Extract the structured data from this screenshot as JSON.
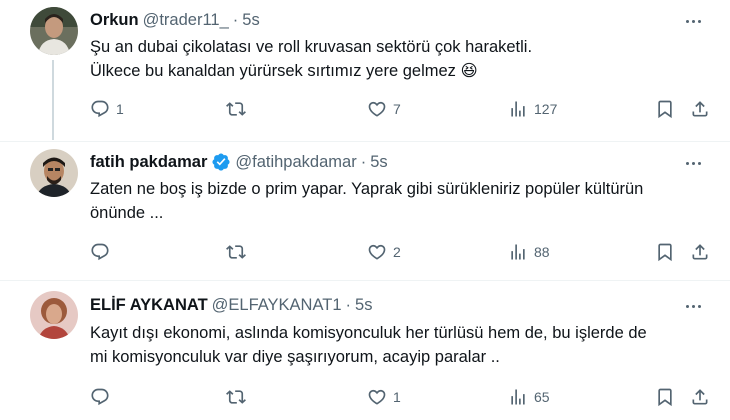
{
  "tweets": [
    {
      "name": "Orkun",
      "handle": "@trader11_",
      "dot": "·",
      "time": "5s",
      "lines": [
        "Şu an dubai çikolatası ve roll kruvasan sektörü çok haraketli.",
        "Ülkece bu kanaldan yürürsek sırtımız yere gelmez 😆"
      ],
      "stats": {
        "replies": "1",
        "retweets": "",
        "likes": "7",
        "views": "127"
      }
    },
    {
      "name": "fatih pakdamar",
      "handle": "@fatihpakdamar",
      "dot": "·",
      "time": "5s",
      "verified": true,
      "lines": [
        "Zaten ne boş iş bizde o prim yapar. Yaprak gibi sürükleniriz popüler kültürün",
        "önünde ..."
      ],
      "stats": {
        "replies": "",
        "retweets": "",
        "likes": "2",
        "views": "88"
      }
    },
    {
      "name": "ELİF AYKANAT",
      "handle": "@ELFAYKANAT1",
      "dot": "·",
      "time": "5s",
      "lines": [
        "Kayıt dışı ekonomi, aslında komisyonculuk her türlüsü hem de, bu işlerde de",
        "mi komisyonculuk var diye şaşırıyorum, acayip paralar .."
      ],
      "stats": {
        "replies": "",
        "retweets": "",
        "likes": "1",
        "views": "65"
      }
    }
  ],
  "colors": {
    "text": "#0f1419",
    "secondary": "#536471",
    "verified": "#1d9bf0",
    "divider": "#eff3f4"
  }
}
